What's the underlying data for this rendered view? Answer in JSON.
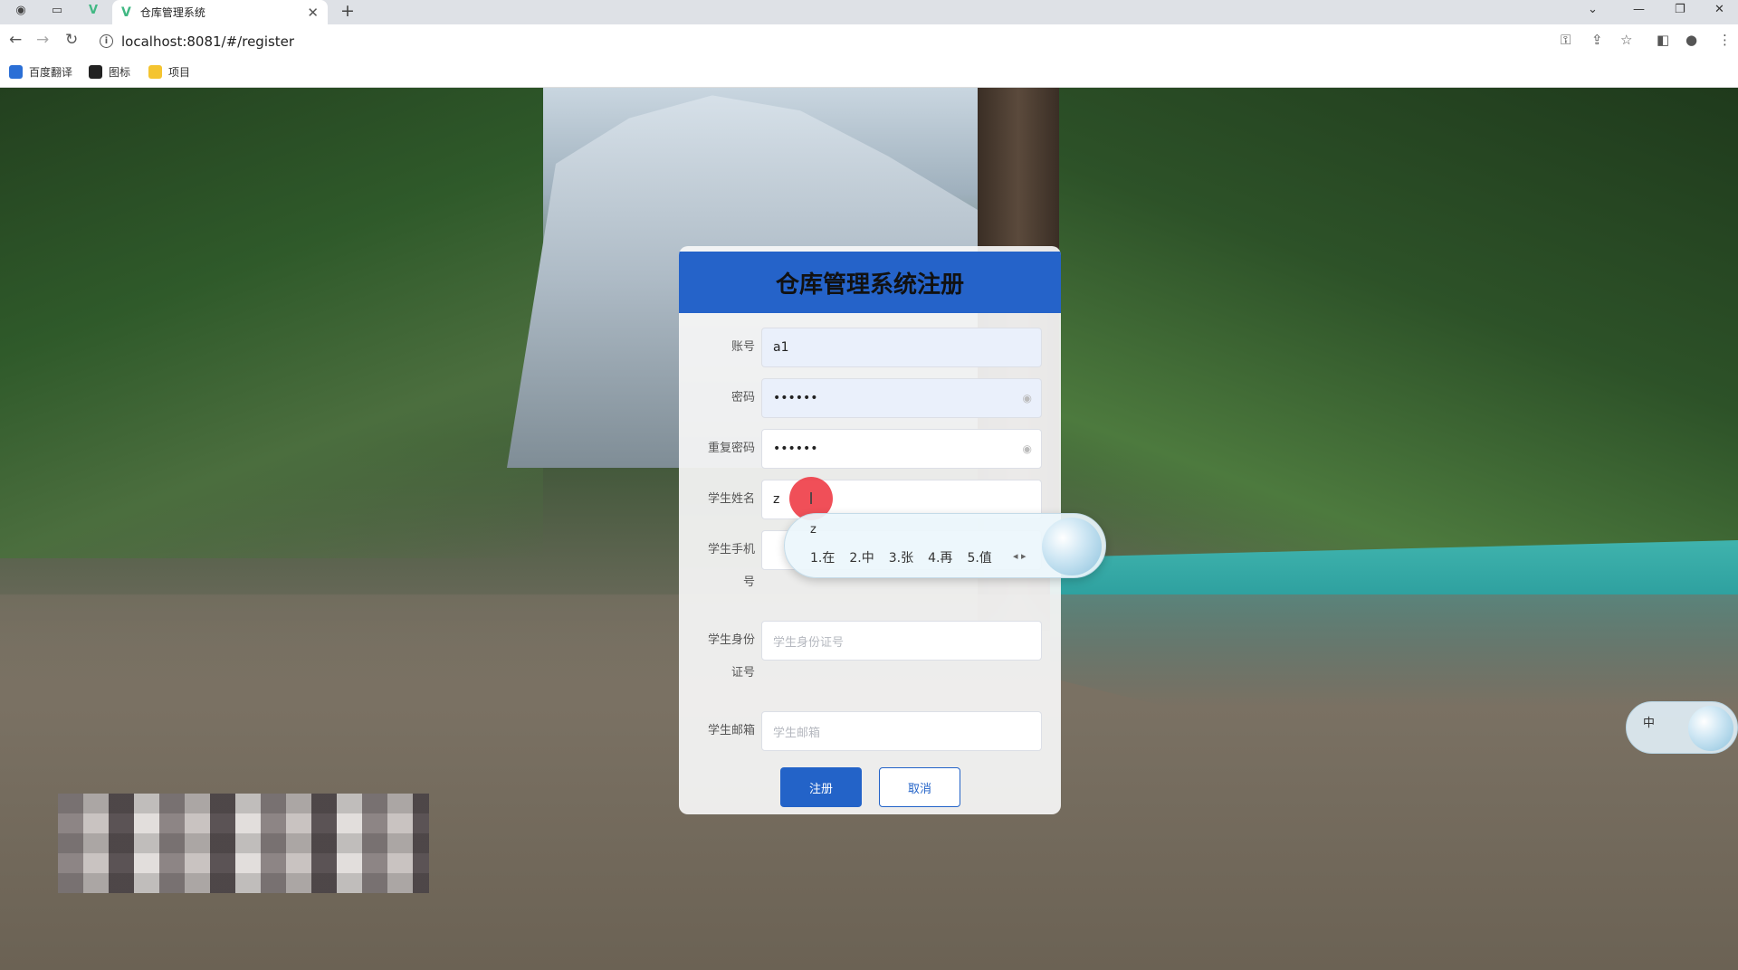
{
  "browser": {
    "tab_title": "仓库管理系统",
    "url": "localhost:8081/#/register",
    "bookmarks": [
      {
        "label": "百度翻译",
        "color": "#2b6fd6"
      },
      {
        "label": "图标",
        "color": "#222222"
      },
      {
        "label": "项目",
        "color": "#f4c430"
      }
    ]
  },
  "card": {
    "title": "仓库管理系统注册",
    "accent": "#2563c9"
  },
  "form": {
    "account": {
      "label": "账号",
      "value": "a1"
    },
    "password": {
      "label": "密码",
      "value": "••••••"
    },
    "repeat_password": {
      "label": "重复密码",
      "value": "••••••"
    },
    "student_name": {
      "label": "学生姓名",
      "value": "z"
    },
    "student_phone": {
      "label_line1": "学生手机",
      "label_line2": "号",
      "placeholder": ""
    },
    "student_id": {
      "label_line1": "学生身份",
      "label_line2": "证号",
      "placeholder": "学生身份证号"
    },
    "student_email": {
      "label": "学生邮箱",
      "placeholder": "学生邮箱"
    },
    "register_button": "注册",
    "cancel_button": "取消"
  },
  "ime": {
    "composition": "z",
    "candidates": [
      "1.在",
      "2.中",
      "3.张",
      "4.再",
      "5.值"
    ],
    "status": "中"
  }
}
